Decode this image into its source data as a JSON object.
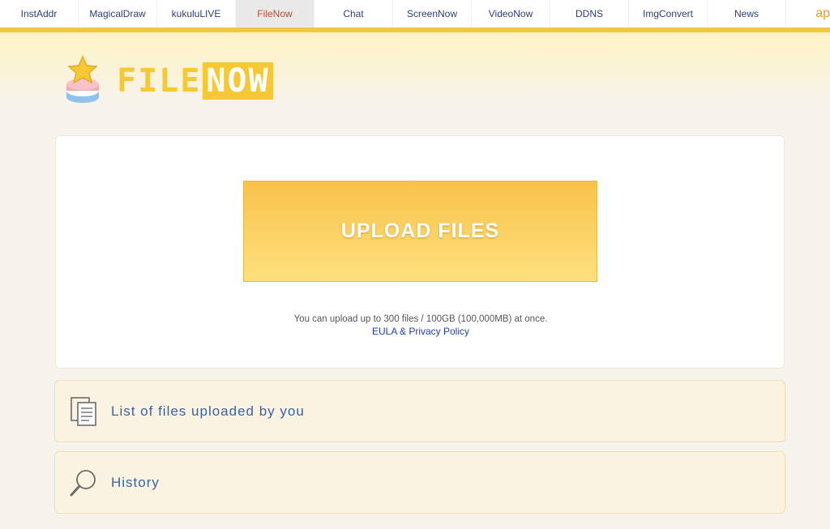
{
  "nav": {
    "items": [
      {
        "label": "InstAddr"
      },
      {
        "label": "MagicalDraw"
      },
      {
        "label": "kukuluLIVE"
      },
      {
        "label": "FileNow"
      },
      {
        "label": "Chat"
      },
      {
        "label": "ScreenNow"
      },
      {
        "label": "VideoNow"
      },
      {
        "label": "DDNS"
      },
      {
        "label": "ImgConvert"
      },
      {
        "label": "News"
      }
    ],
    "active": "FileNow",
    "extra_label": "ap"
  },
  "logo": {
    "file": "FILE",
    "now": "NOW"
  },
  "upload": {
    "button_label": "UPLOAD FILES",
    "limit_text": "You can upload up to 300 files / 100GB (100,000MB) at once.",
    "eula_link": "EULA & Privacy Policy"
  },
  "panels": {
    "files": {
      "label": "List of files uploaded by you",
      "icon": "documents-icon"
    },
    "history": {
      "label": "History",
      "icon": "search-icon"
    }
  },
  "colors": {
    "accent": "#f4c542",
    "link": "#1f3fae",
    "panel_text": "#3a62a8"
  }
}
